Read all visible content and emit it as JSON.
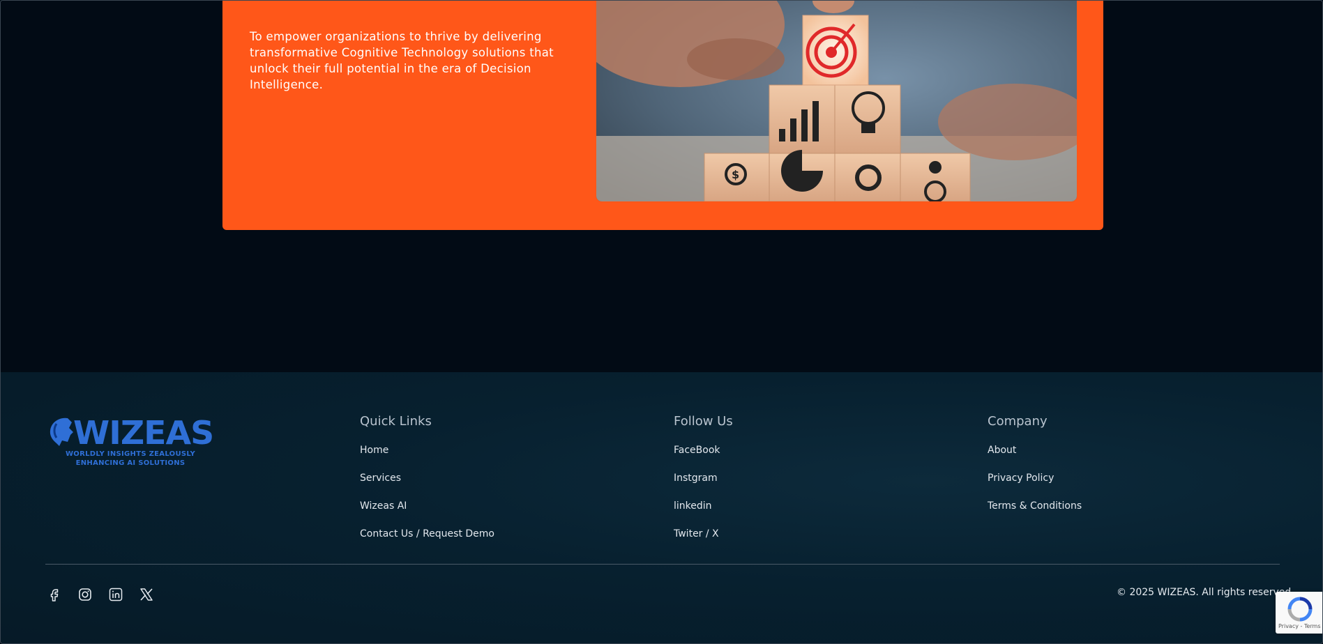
{
  "mission": {
    "text": "To empower organizations to thrive by delivering transformative Cognitive Technology solutions that unlock their full potential in the era of Decision Intelligence."
  },
  "logo": {
    "wordmark": "WIZEAS",
    "tagline_line1": "WORLDLY INSIGHTS ZEALOUSLY",
    "tagline_line2": "ENHANCING AI SOLUTIONS",
    "color": "#2f6fd6"
  },
  "footer": {
    "quick_links": {
      "title": "Quick Links",
      "items": [
        "Home",
        "Services",
        "Wizeas AI",
        "Contact Us / Request Demo"
      ]
    },
    "follow_us": {
      "title": "Follow Us",
      "items": [
        "FaceBook",
        "Instgram",
        "linkedin",
        "Twiter / X"
      ]
    },
    "company": {
      "title": "Company",
      "items": [
        "About",
        "Privacy Policy",
        "Terms & Conditions"
      ]
    },
    "social_icons": [
      "facebook-icon",
      "instagram-icon",
      "linkedin-icon",
      "x-icon"
    ],
    "copyright": "© 2025 WIZEAS. All rights reserved."
  },
  "recaptcha": {
    "text": "Privacy - Terms"
  },
  "colors": {
    "accent_orange": "#ff5719",
    "background_dark": "#020b15",
    "footer_bg": "#07202f",
    "brand_blue": "#2f6fd6"
  }
}
